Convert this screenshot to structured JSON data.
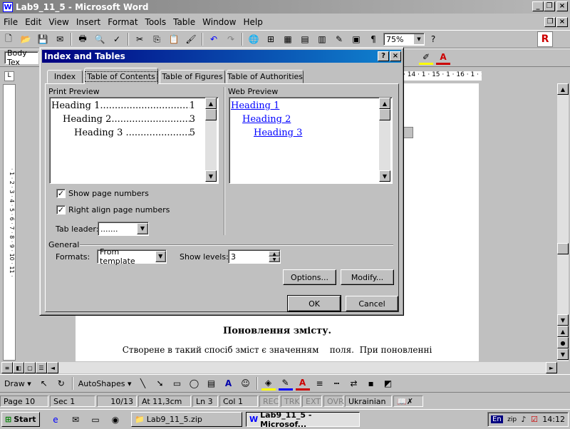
{
  "window": {
    "title": "Lab9_11_5 - Microsoft Word"
  },
  "menu": [
    "File",
    "Edit",
    "View",
    "Insert",
    "Format",
    "Tools",
    "Table",
    "Window",
    "Help"
  ],
  "toolbar": {
    "zoom": "75%",
    "style": "Body Tex"
  },
  "ruler": {
    "ticks": "· 14 · 1 · 15 · 1 · 16 · 1 · 17 · 1 ·"
  },
  "dialog": {
    "title": "Index and Tables",
    "tabs": [
      "Index",
      "Table of Contents",
      "Table of Figures",
      "Table of Authorities"
    ],
    "print_preview_label": "Print Preview",
    "web_preview_label": "Web Preview",
    "print_entries": [
      {
        "text": "Heading 1",
        "page": "1"
      },
      {
        "text": "Heading 2",
        "page": "3"
      },
      {
        "text": "Heading 3 ",
        "page": "5"
      }
    ],
    "web_entries": [
      "Heading 1",
      "Heading 2",
      "Heading 3"
    ],
    "show_page_numbers": "Show page numbers",
    "right_align": "Right align page numbers",
    "tab_leader_label": "Tab leader:",
    "tab_leader_value": ".......",
    "general_label": "General",
    "formats_label": "Formats:",
    "formats_value": "From template",
    "show_levels_label": "Show levels:",
    "show_levels_value": "3",
    "options": "Options...",
    "modify": "Modify...",
    "ok": "OK",
    "cancel": "Cancel"
  },
  "document": {
    "heading": "Поновлення змісту.",
    "body": "Створене в такий спосіб зміст є значенням    поля.  При поновленні"
  },
  "drawbar": {
    "draw": "Draw",
    "autoshapes": "AutoShapes"
  },
  "status": {
    "page": "Page 10",
    "sec": "Sec 1",
    "pages": "10/13",
    "at": "At 11,3cm",
    "ln": "Ln 3",
    "col": "Col 1",
    "rec": "REC",
    "trk": "TRK",
    "ext": "EXT",
    "ovr": "OVR",
    "lang": "Ukrainian"
  },
  "taskbar": {
    "start": "Start",
    "task1": "Lab9_11_5.zip",
    "task2": "Lab9_11_5 - Microsof...",
    "lang": "En",
    "clock": "14:12"
  }
}
